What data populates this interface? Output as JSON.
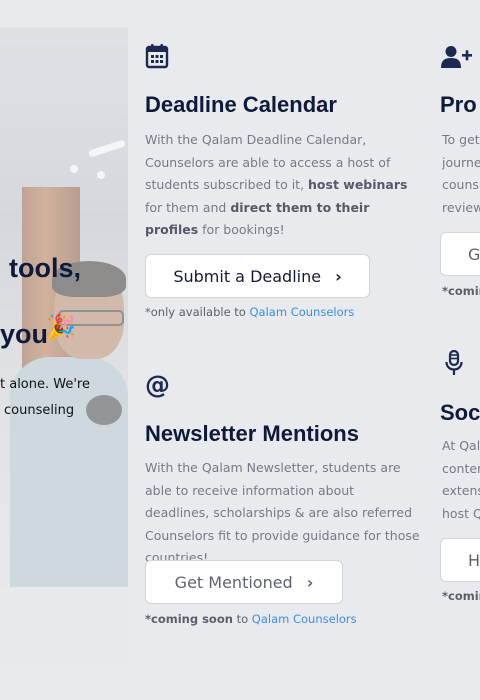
{
  "hero": {
    "line1": "tools,",
    "line2": "you",
    "sub1": "t alone. We're",
    "sub2": "counseling"
  },
  "cards": {
    "calendar": {
      "icon": "calendar-icon",
      "title": "Deadline Calendar",
      "desc_pre": "With the Qalam Deadline Calendar, Counselors are able to access a host of students subscribed to it, ",
      "desc_bold1": "host webinars",
      "desc_mid": " for them and ",
      "desc_bold2": "direct them to their profiles",
      "desc_post": " for bookings!",
      "button": "Submit a Deadline",
      "note_pre": "*only available to ",
      "note_link": "Qalam Counselors"
    },
    "newsletter": {
      "icon": "at-sign-icon",
      "title": "Newsletter Mentions",
      "desc": "With the Qalam Newsletter, students are able to receive information about deadlines, scholarships & are also referred Counselors fit to provide guidance for those countries!",
      "button": "Get Mentioned",
      "note_bold": "*coming soon",
      "note_mid": " to ",
      "note_link": "Qalam Counselors"
    },
    "profile": {
      "icon": "user-plus-icon",
      "title": "Pro",
      "desc_lines": [
        "To get",
        "journe",
        "couns",
        "review"
      ],
      "button": "G",
      "note": "*comin"
    },
    "social": {
      "icon": "microphone-icon",
      "title": "Soc",
      "desc_lines": [
        "At Qal",
        "conter",
        "extens",
        "host Q"
      ],
      "button": "H",
      "note": "*comin"
    }
  },
  "colors": {
    "background": "#e9eaed",
    "heading": "#0e1a3a",
    "link": "#3b8ee6"
  }
}
